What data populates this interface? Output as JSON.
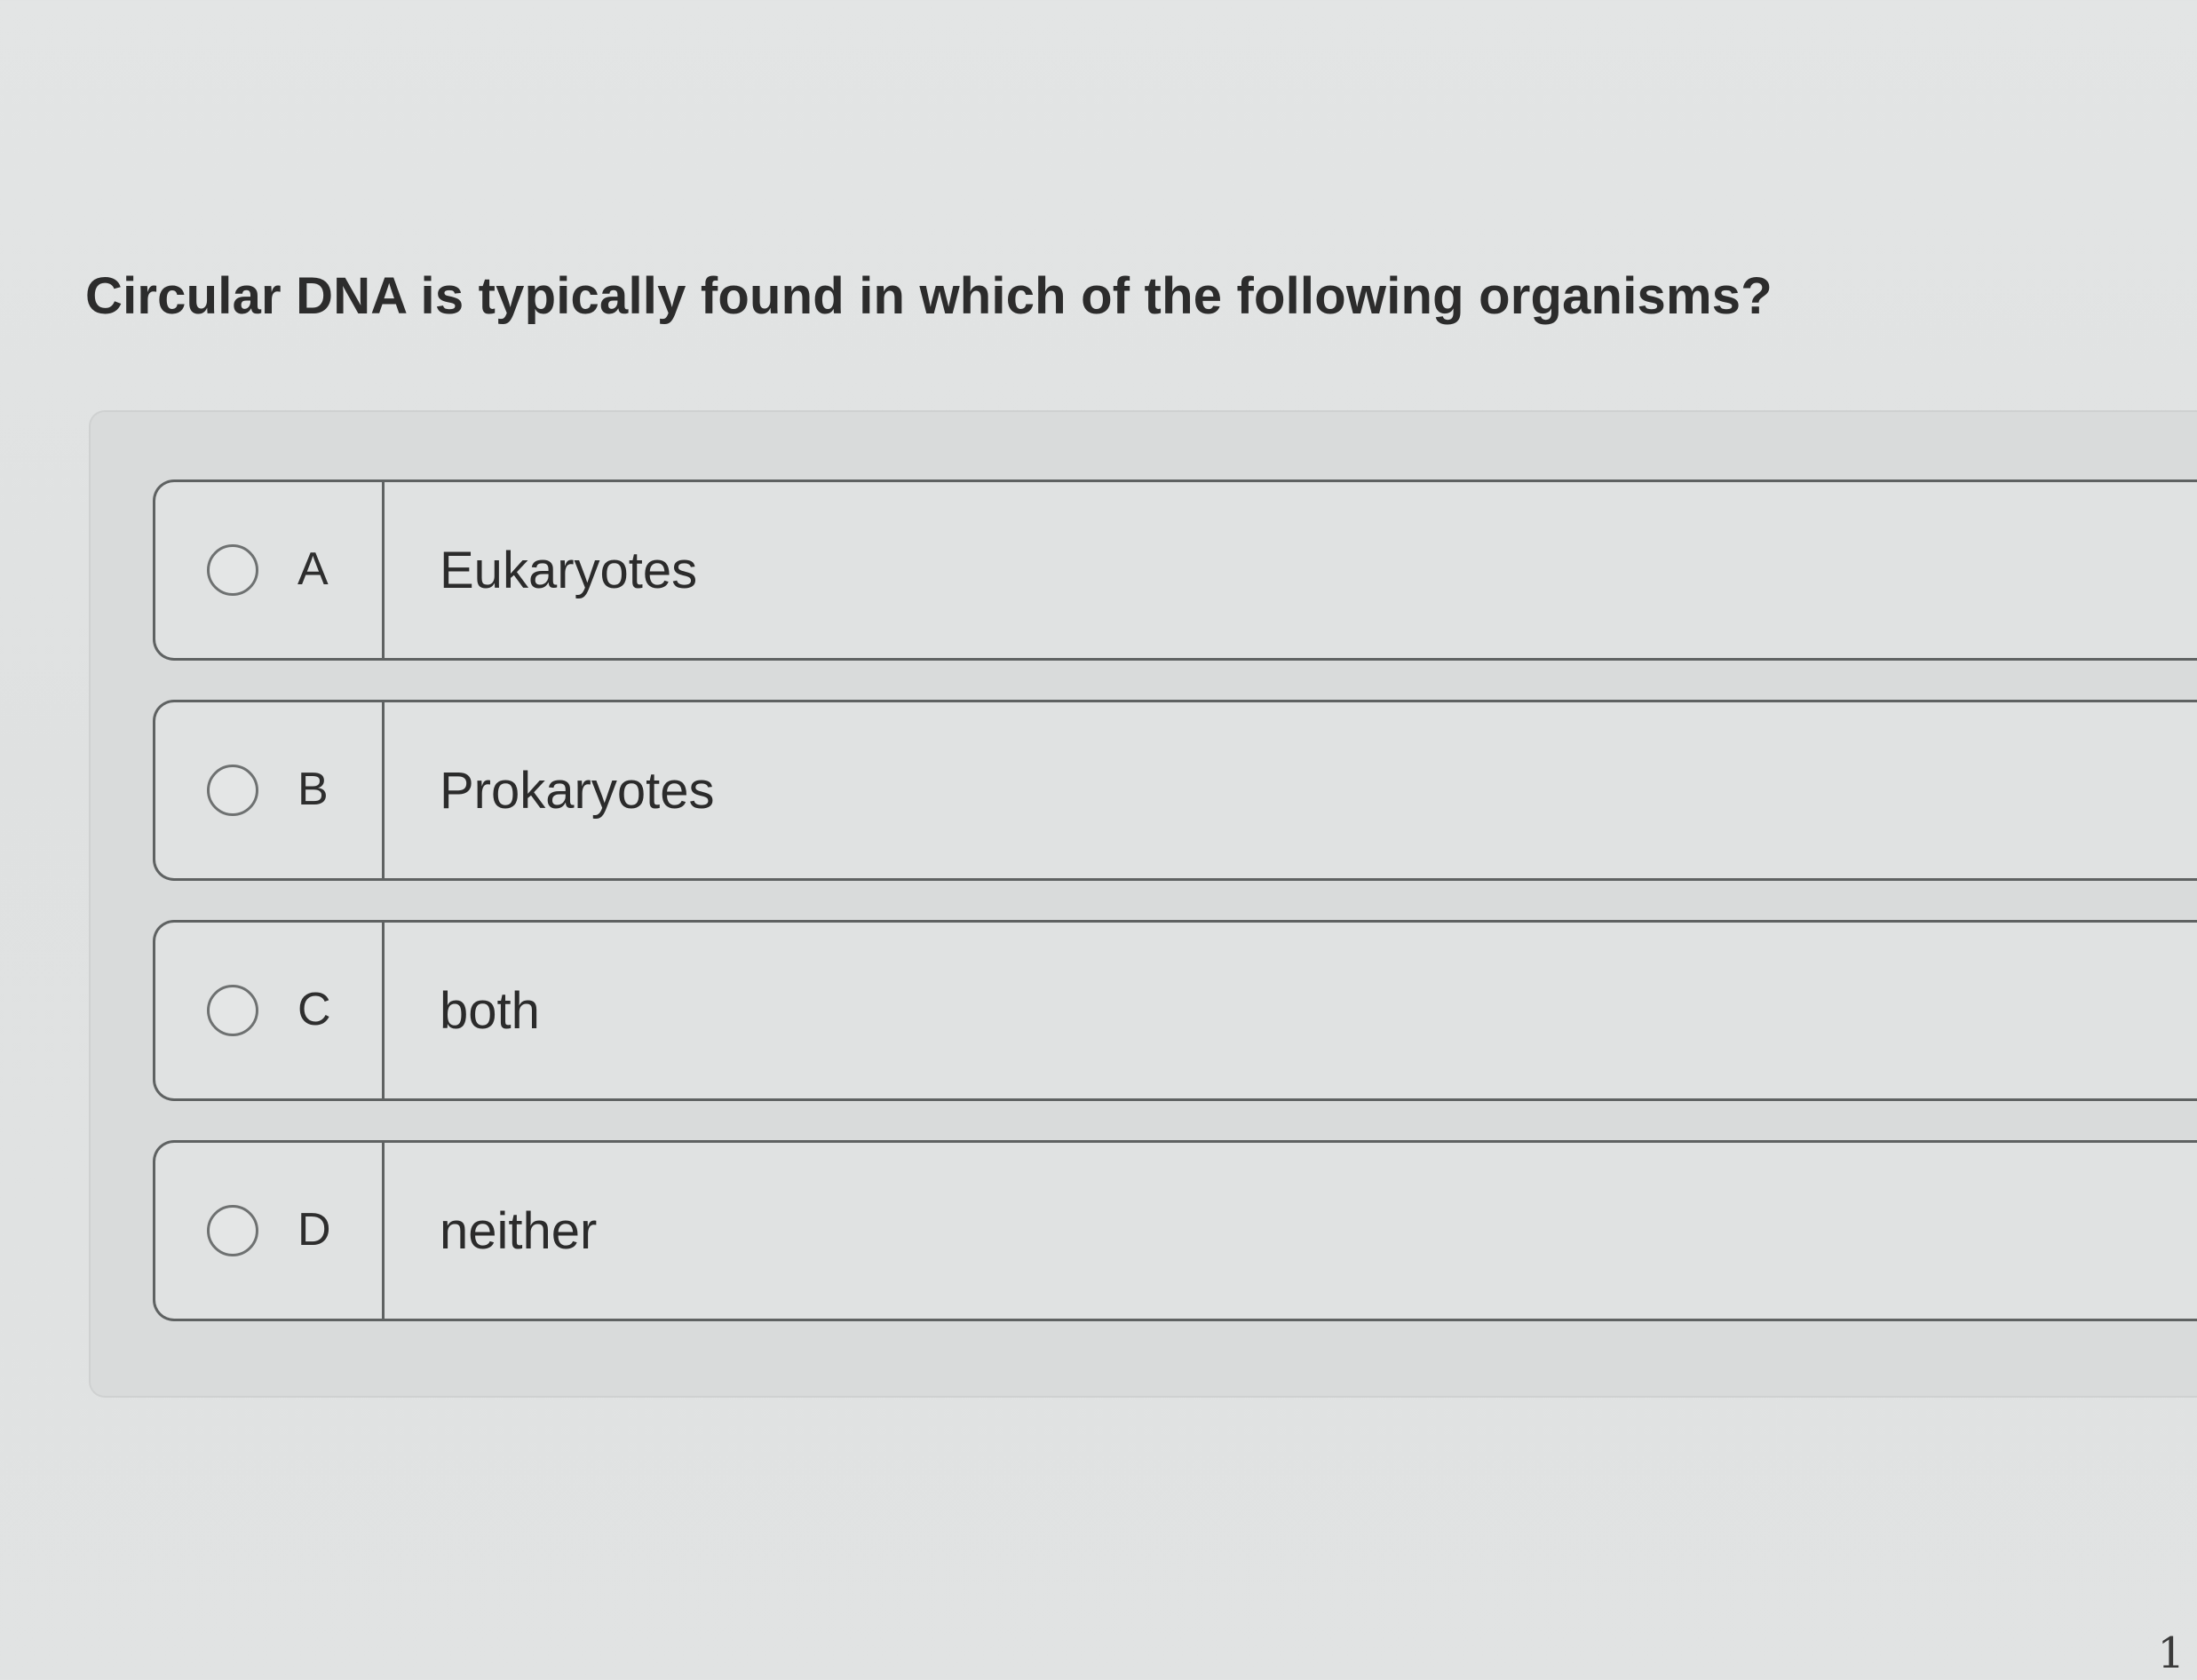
{
  "question": {
    "text": "Circular DNA is typically found in which of the following organisms?"
  },
  "options": [
    {
      "letter": "A",
      "text": "Eukaryotes"
    },
    {
      "letter": "B",
      "text": "Prokaryotes"
    },
    {
      "letter": "C",
      "text": "both"
    },
    {
      "letter": "D",
      "text": "neither"
    }
  ],
  "page_number": "1"
}
